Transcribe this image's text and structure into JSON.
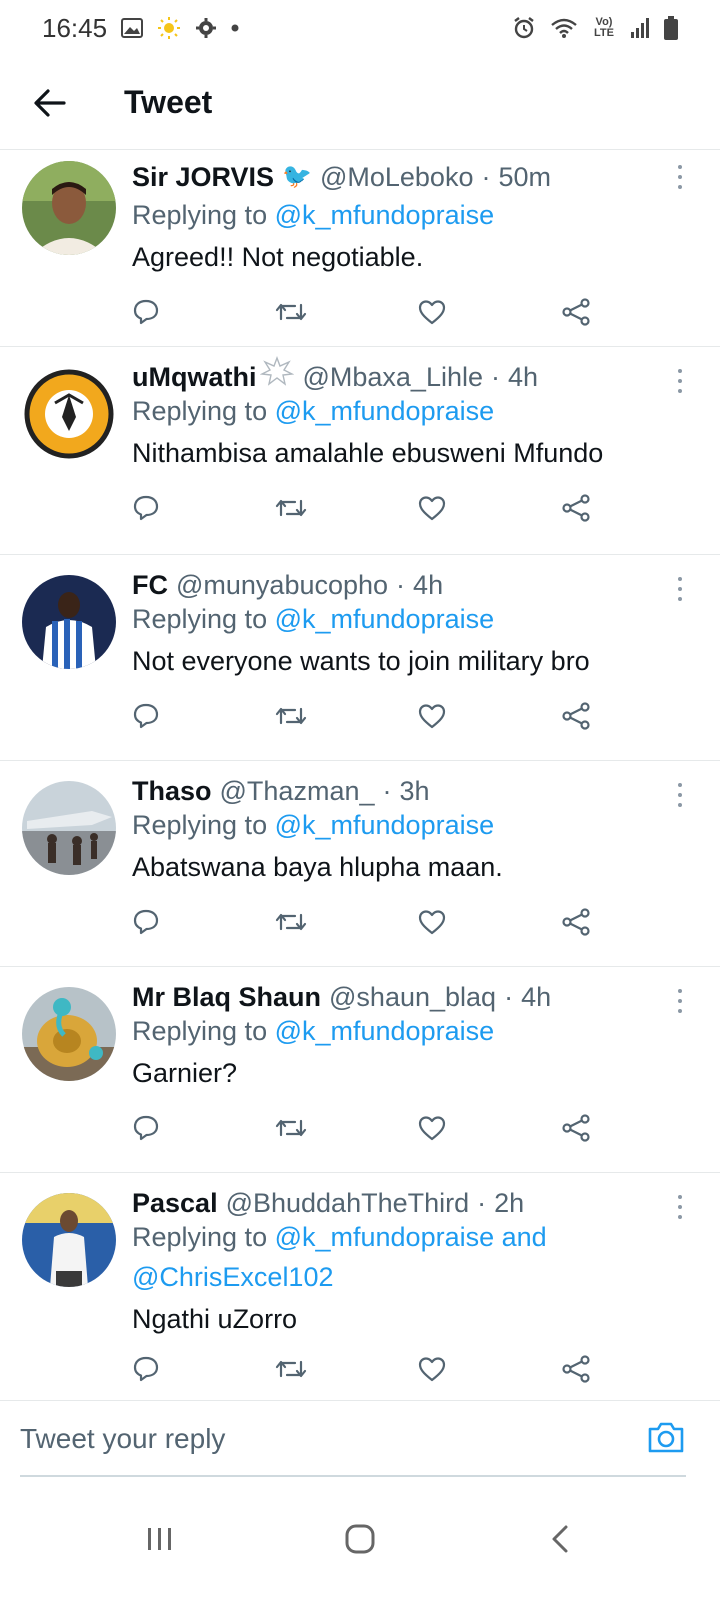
{
  "status_bar": {
    "time": "16:45",
    "network_label": "Vo) LTE"
  },
  "header": {
    "title": "Tweet"
  },
  "tweets": [
    {
      "name": "Sir JORVIS",
      "badge": "🐦",
      "handle": "@MoLeboko",
      "time": "50m",
      "reply_prefix": "Replying to ",
      "reply_mentions": "@k_mfundopraise",
      "reply_mentions_2": "",
      "text": "Agreed!! Not negotiable.",
      "avatar_color": "#6b8a4a"
    },
    {
      "name": "uMqwathi",
      "badge": "💥",
      "handle": "@Mbaxa_Lihle",
      "time": "4h",
      "reply_prefix": "Replying to ",
      "reply_mentions": "@k_mfundopraise",
      "reply_mentions_2": "",
      "text": "Nithambisa amalahle ebusweni Mfundo",
      "avatar_color": "#f2a81d"
    },
    {
      "name": "FC",
      "badge": "",
      "handle": "@munyabucopho",
      "time": "4h",
      "reply_prefix": "Replying to ",
      "reply_mentions": "@k_mfundopraise",
      "reply_mentions_2": "",
      "text": "Not everyone wants to join military bro",
      "avatar_color": "#1b2a52"
    },
    {
      "name": "Thaso",
      "badge": "",
      "handle": "@Thazman_",
      "time": "3h",
      "reply_prefix": "Replying to ",
      "reply_mentions": "@k_mfundopraise",
      "reply_mentions_2": "",
      "text": "Abatswana baya hlupha maan.",
      "avatar_color": "#8a8f94"
    },
    {
      "name": "Mr Blaq Shaun",
      "badge": "",
      "handle": "@shaun_blaq",
      "time": "4h",
      "reply_prefix": "Replying to ",
      "reply_mentions": "@k_mfundopraise",
      "reply_mentions_2": "",
      "text": "Garnier?",
      "avatar_color": "#c9a35a"
    },
    {
      "name": "Pascal",
      "badge": "",
      "handle": "@BhuddahTheThird",
      "time": "2h",
      "reply_prefix": "Replying to ",
      "reply_mentions": "@k_mfundopraise and",
      "reply_mentions_2": "@ChrisExcel102",
      "text": "Ngathi uZorro",
      "avatar_color": "#2a5fa8"
    }
  ],
  "reply_bar": {
    "placeholder": "Tweet your reply"
  },
  "colors": {
    "accent": "#1d9bf0",
    "secondary_text": "#536471",
    "primary_text": "#0f1419",
    "divider": "#e6e9ea"
  },
  "icons": {
    "back": "arrow-left-icon",
    "reply": "comment-icon",
    "retweet": "retweet-icon",
    "like": "heart-icon",
    "share": "share-icon",
    "more": "more-vertical-icon",
    "camera": "camera-icon"
  }
}
